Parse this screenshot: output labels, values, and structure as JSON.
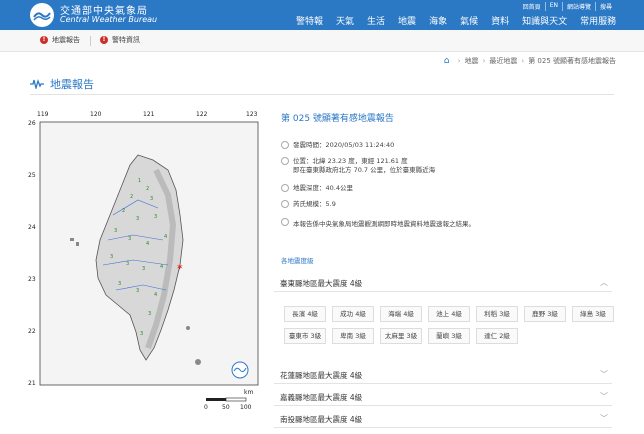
{
  "header": {
    "brand_zh": "交通部中央氣象局",
    "brand_en": "Central Weather Bureau",
    "utility": [
      "回首頁",
      "EN",
      "網站導覽",
      "搜尋"
    ],
    "nav": [
      "警特報",
      "天氣",
      "生活",
      "地震",
      "海象",
      "氣候",
      "資料",
      "知識與天文",
      "常用服務"
    ]
  },
  "alerts": [
    {
      "label": "地震報告"
    },
    {
      "label": "警特資訊"
    }
  ],
  "breadcrumb": [
    "地震",
    "最近地震",
    "第 025 號顯著有感地震報告"
  ],
  "page_title": "地震報告",
  "map": {
    "x_ticks": [
      "119",
      "120",
      "121",
      "122",
      "123"
    ],
    "y_ticks": [
      "26",
      "25",
      "24",
      "23",
      "22",
      "21"
    ],
    "scale_unit": "km",
    "scale_ticks": [
      "0",
      "50",
      "100"
    ]
  },
  "report": {
    "title": "第 025 號顯著有感地震報告",
    "time": "發震時間：2020/05/03 11:24:40",
    "location_1": "位置：北緯 23.23 度，東經 121.61 度",
    "location_2": "即在臺東縣政府北方 70.7 公里，位於臺東縣近海",
    "depth": "地震深度：40.4公里",
    "magnitude": "芮氏規模：5.9",
    "note": "本報告係中央氣象局地震觀測網即時地震資料地震速報之結果。",
    "station_link": "各地震度級"
  },
  "regions": [
    {
      "label": "臺東縣地區最大震度 4級",
      "expanded": true,
      "stations": [
        "長濱 4級",
        "成功 4級",
        "海端 4級",
        "池上 4級",
        "利稻 3級",
        "鹿野 3級",
        "綠島 3級",
        "臺東市 3級",
        "卑南 3級",
        "太麻里 3級",
        "蘭嶼 3級",
        "達仁 2級"
      ]
    },
    {
      "label": "花蓮縣地區最大震度 4級",
      "expanded": false
    },
    {
      "label": "嘉義縣地區最大震度 4級",
      "expanded": false
    },
    {
      "label": "南投縣地區最大震度 4級",
      "expanded": false
    }
  ],
  "colors": {
    "brand": "#2b78c5",
    "alert": "#c9302c",
    "epicenter": "#e02020"
  }
}
